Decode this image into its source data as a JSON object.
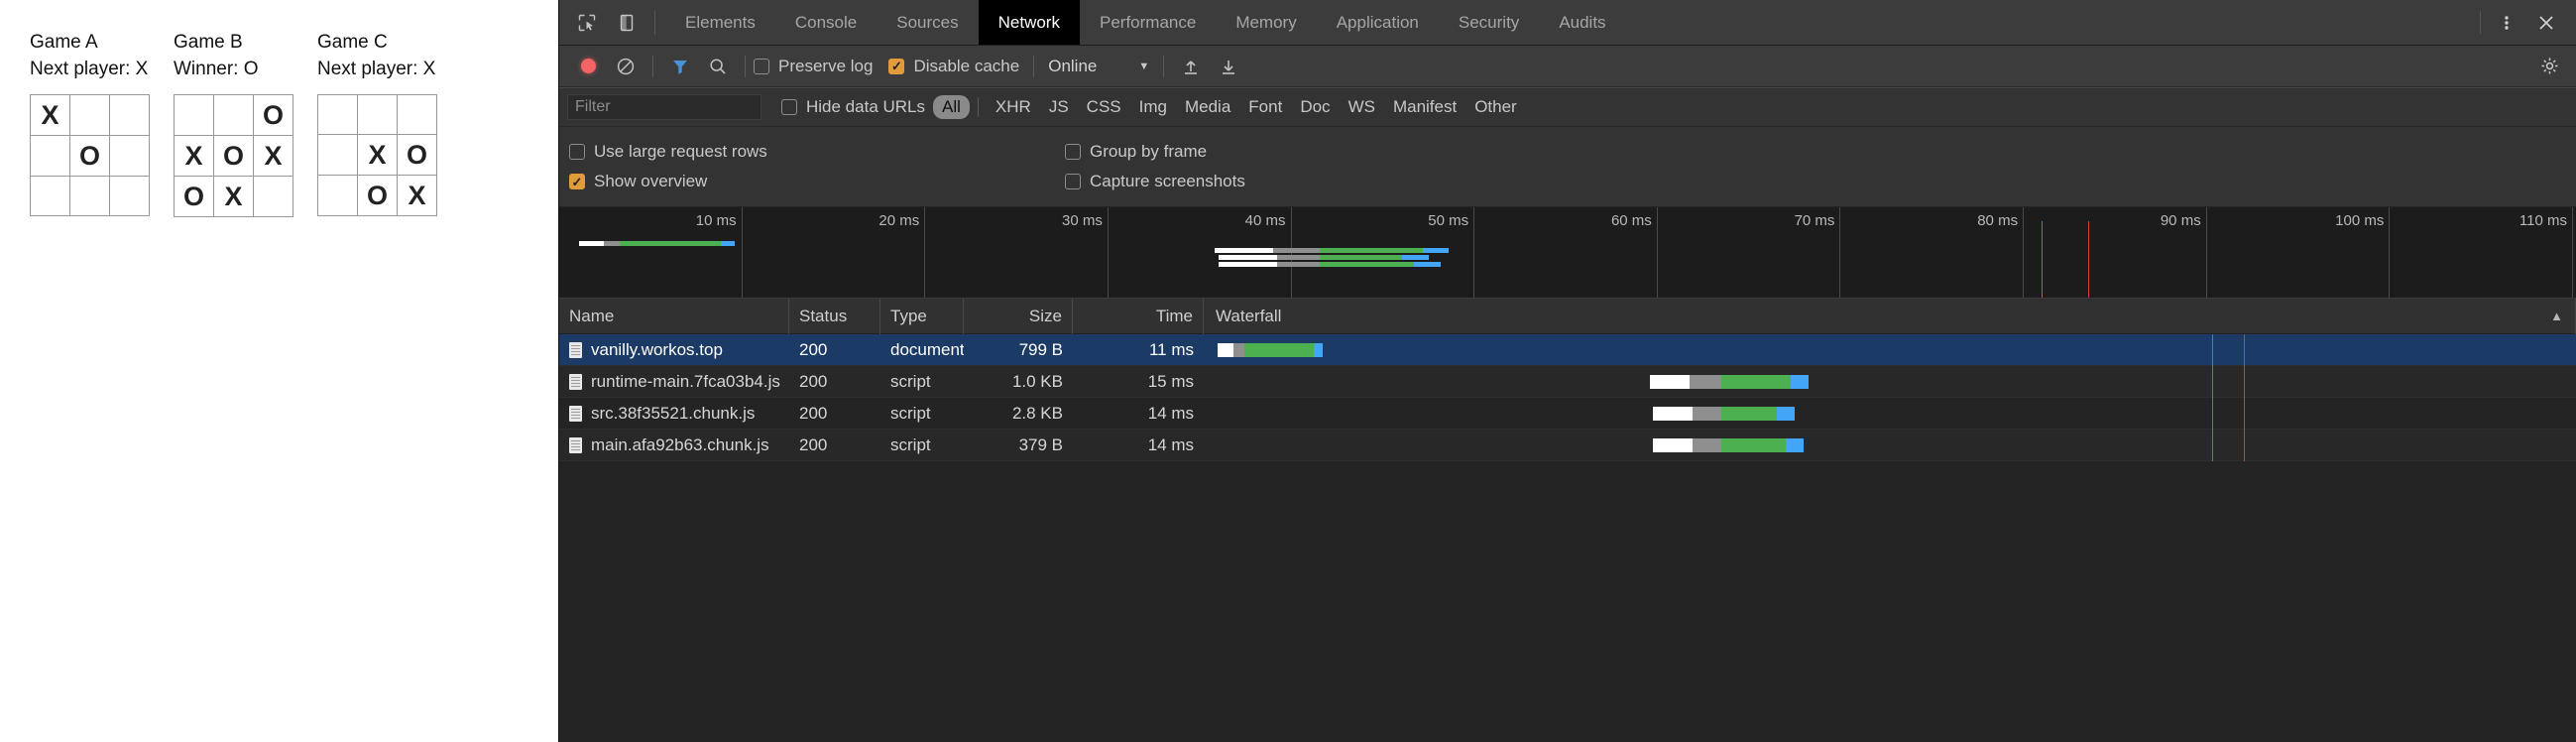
{
  "games": [
    {
      "title": "Game A",
      "status": "Next player: X",
      "cells": [
        "X",
        "",
        "",
        "",
        "O",
        "",
        "",
        "",
        ""
      ]
    },
    {
      "title": "Game B",
      "status": "Winner: O",
      "cells": [
        "",
        "",
        "O",
        "X",
        "O",
        "X",
        "O",
        "X",
        ""
      ]
    },
    {
      "title": "Game C",
      "status": "Next player: X",
      "cells": [
        "",
        "",
        "",
        "",
        "X",
        "O",
        "",
        "O",
        "X"
      ]
    }
  ],
  "devtools": {
    "tabs": [
      {
        "label": "Elements",
        "active": false
      },
      {
        "label": "Console",
        "active": false
      },
      {
        "label": "Sources",
        "active": false
      },
      {
        "label": "Network",
        "active": true
      },
      {
        "label": "Performance",
        "active": false
      },
      {
        "label": "Memory",
        "active": false
      },
      {
        "label": "Application",
        "active": false
      },
      {
        "label": "Security",
        "active": false
      },
      {
        "label": "Audits",
        "active": false
      }
    ],
    "tabbar_icons": {
      "inspect": "inspect-element-icon",
      "device": "toggle-device-toolbar-icon",
      "more": "more-options-icon",
      "close": "close-devtools-icon",
      "settings": "settings-gear-icon"
    },
    "toolbar": {
      "record_label": "record-button",
      "clear_label": "clear-button",
      "filter_label": "filter-toggle-button",
      "search_label": "search-button",
      "preserve_log": "Preserve log",
      "preserve_log_checked": false,
      "disable_cache": "Disable cache",
      "disable_cache_checked": true,
      "throttling": "Online",
      "caret": "▼",
      "import_label": "import-har-button",
      "export_label": "export-har-button"
    },
    "filterbar": {
      "filter_placeholder": "Filter",
      "filter_value": "",
      "hide_data_urls": "Hide data URLs",
      "hide_data_urls_checked": false,
      "types": [
        {
          "label": "All",
          "active": true
        },
        {
          "label": "XHR",
          "active": false
        },
        {
          "label": "JS",
          "active": false
        },
        {
          "label": "CSS",
          "active": false
        },
        {
          "label": "Img",
          "active": false
        },
        {
          "label": "Media",
          "active": false
        },
        {
          "label": "Font",
          "active": false
        },
        {
          "label": "Doc",
          "active": false
        },
        {
          "label": "WS",
          "active": false
        },
        {
          "label": "Manifest",
          "active": false
        },
        {
          "label": "Other",
          "active": false
        }
      ]
    },
    "settings": {
      "use_large_request_rows": "Use large request rows",
      "use_large_request_rows_checked": false,
      "group_by_frame": "Group by frame",
      "group_by_frame_checked": false,
      "show_overview": "Show overview",
      "show_overview_checked": true,
      "capture_screenshots": "Capture screenshots",
      "capture_screenshots_checked": false
    },
    "overview": {
      "ticks": [
        "10 ms",
        "20 ms",
        "30 ms",
        "40 ms",
        "50 ms",
        "60 ms",
        "70 ms",
        "80 ms",
        "90 ms",
        "100 ms",
        "110 ms"
      ],
      "tick_step_ms": 10,
      "max_ms": 110
    },
    "table": {
      "columns": [
        "Name",
        "Status",
        "Type",
        "Size",
        "Time",
        "Waterfall"
      ],
      "sort_indicator": "▲",
      "rows": [
        {
          "name": "vanilly.workos.top",
          "status": "200",
          "type": "document",
          "size": "799 B",
          "time": "11 ms",
          "selected": true,
          "wf_start_pct": 1.0,
          "wf_stalled_pct": 1.2,
          "wf_wait_pct": 0.8,
          "wf_download_pct": 5.0,
          "wf_tail_pct": 0.7
        },
        {
          "name": "runtime-main.7fca03b4.js",
          "status": "200",
          "type": "script",
          "size": "1.0 KB",
          "time": "15 ms",
          "selected": false,
          "wf_start_pct": 32.5,
          "wf_stalled_pct": 2.9,
          "wf_wait_pct": 2.3,
          "wf_download_pct": 5.1,
          "wf_tail_pct": 1.3
        },
        {
          "name": "src.38f35521.chunk.js",
          "status": "200",
          "type": "script",
          "size": "2.8 KB",
          "time": "14 ms",
          "selected": false,
          "wf_start_pct": 32.7,
          "wf_stalled_pct": 2.9,
          "wf_wait_pct": 2.1,
          "wf_download_pct": 4.1,
          "wf_tail_pct": 1.3
        },
        {
          "name": "main.afa92b63.chunk.js",
          "status": "200",
          "type": "script",
          "size": "379 B",
          "time": "14 ms",
          "selected": false,
          "wf_start_pct": 32.7,
          "wf_stalled_pct": 2.9,
          "wf_wait_pct": 2.1,
          "wf_download_pct": 4.7,
          "wf_tail_pct": 1.3
        }
      ],
      "event_lines": [
        {
          "name": "dom-content-loaded-line",
          "color": "#3a7fe0",
          "pct": 73.5
        },
        {
          "name": "load-event-line",
          "color": "#d23c3c",
          "pct": 75.8
        }
      ]
    },
    "colors": {
      "record": "#f46464",
      "filter_active": "#4a90d9",
      "checkbox_checked": "#e09b3d",
      "selected_row": "#1c3a66",
      "waterfall_stalled": "#ffffff",
      "waterfall_wait": "#8f8f8f",
      "waterfall_download": "#4caf50",
      "waterfall_tail": "#42a5f5",
      "tab_active_bg": "#000000"
    }
  }
}
